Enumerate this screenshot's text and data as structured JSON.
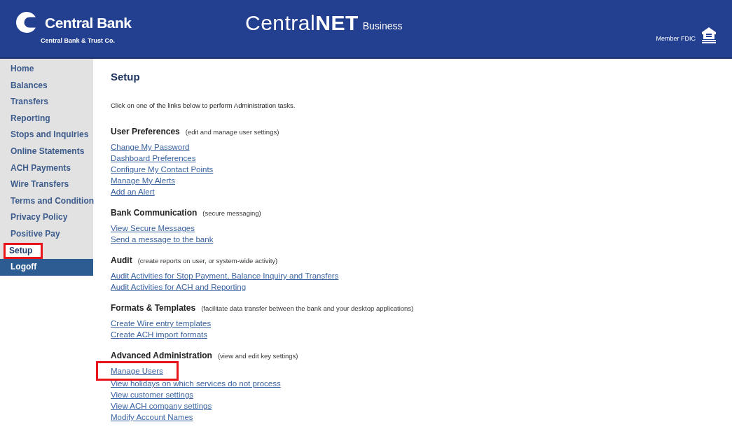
{
  "header": {
    "bank_name": "Central Bank",
    "bank_subtitle": "Central Bank & Trust Co.",
    "product": "Central**NET**",
    "product_suffix": "Business",
    "member": "Member FDIC"
  },
  "sidebar": {
    "items": [
      {
        "label": "Home",
        "kind": "link",
        "selected": false,
        "highlighted": false
      },
      {
        "label": "Balances",
        "kind": "link",
        "selected": false,
        "highlighted": false
      },
      {
        "label": "Transfers",
        "kind": "link",
        "selected": false,
        "highlighted": false
      },
      {
        "label": "Reporting",
        "kind": "link",
        "selected": false,
        "highlighted": false
      },
      {
        "label": "Stops and Inquiries",
        "kind": "link",
        "selected": false,
        "highlighted": false
      },
      {
        "label": "Online Statements",
        "kind": "link",
        "selected": false,
        "highlighted": false
      },
      {
        "label": "ACH Payments",
        "kind": "link",
        "selected": false,
        "highlighted": false
      },
      {
        "label": "Wire Transfers",
        "kind": "link",
        "selected": false,
        "highlighted": false
      },
      {
        "label": "Terms and Condition",
        "kind": "link",
        "selected": false,
        "highlighted": false
      },
      {
        "label": "Privacy Policy",
        "kind": "link",
        "selected": false,
        "highlighted": false
      },
      {
        "label": "Positive Pay",
        "kind": "link",
        "selected": false,
        "highlighted": false
      },
      {
        "label": "Setup",
        "kind": "link",
        "selected": true,
        "highlighted": true
      },
      {
        "label": "Logoff",
        "kind": "logoff",
        "selected": false,
        "highlighted": false
      }
    ]
  },
  "page": {
    "title": "Setup",
    "intro": "Click on one of the links below to perform Administration tasks.",
    "sections": [
      {
        "heading": "User Preferences",
        "note": "(edit and manage user settings)",
        "links": [
          {
            "label": "Change My Password",
            "highlighted": false
          },
          {
            "label": "Dashboard Preferences",
            "highlighted": false
          },
          {
            "label": "Configure My Contact Points",
            "highlighted": false
          },
          {
            "label": "Manage My Alerts",
            "highlighted": false
          },
          {
            "label": "Add an Alert",
            "highlighted": false
          }
        ]
      },
      {
        "heading": "Bank Communication",
        "note": "(secure messaging)",
        "links": [
          {
            "label": "View Secure Messages",
            "highlighted": false
          },
          {
            "label": "Send a message to the bank",
            "highlighted": false
          }
        ]
      },
      {
        "heading": "Audit",
        "note": "(create reports on user, or system-wide activity)",
        "links": [
          {
            "label": "Audit Activities for Stop Payment, Balance Inquiry and Transfers",
            "highlighted": false
          },
          {
            "label": "Audit Activities for ACH and Reporting",
            "highlighted": false
          }
        ]
      },
      {
        "heading": "Formats & Templates",
        "note": "(facilitate data transfer between the bank and your desktop applications)",
        "links": [
          {
            "label": "Create Wire entry templates",
            "highlighted": false
          },
          {
            "label": "Create ACH import formats",
            "highlighted": false
          }
        ]
      },
      {
        "heading": "Advanced Administration",
        "note": "(view and edit key settings)",
        "links": [
          {
            "label": "Manage Users",
            "highlighted": true
          },
          {
            "label": "View holidays on which services do not process",
            "highlighted": false
          },
          {
            "label": "View customer settings",
            "highlighted": false
          },
          {
            "label": "View ACH company settings",
            "highlighted": false
          },
          {
            "label": "Modify Account Names",
            "highlighted": false
          }
        ]
      }
    ]
  }
}
